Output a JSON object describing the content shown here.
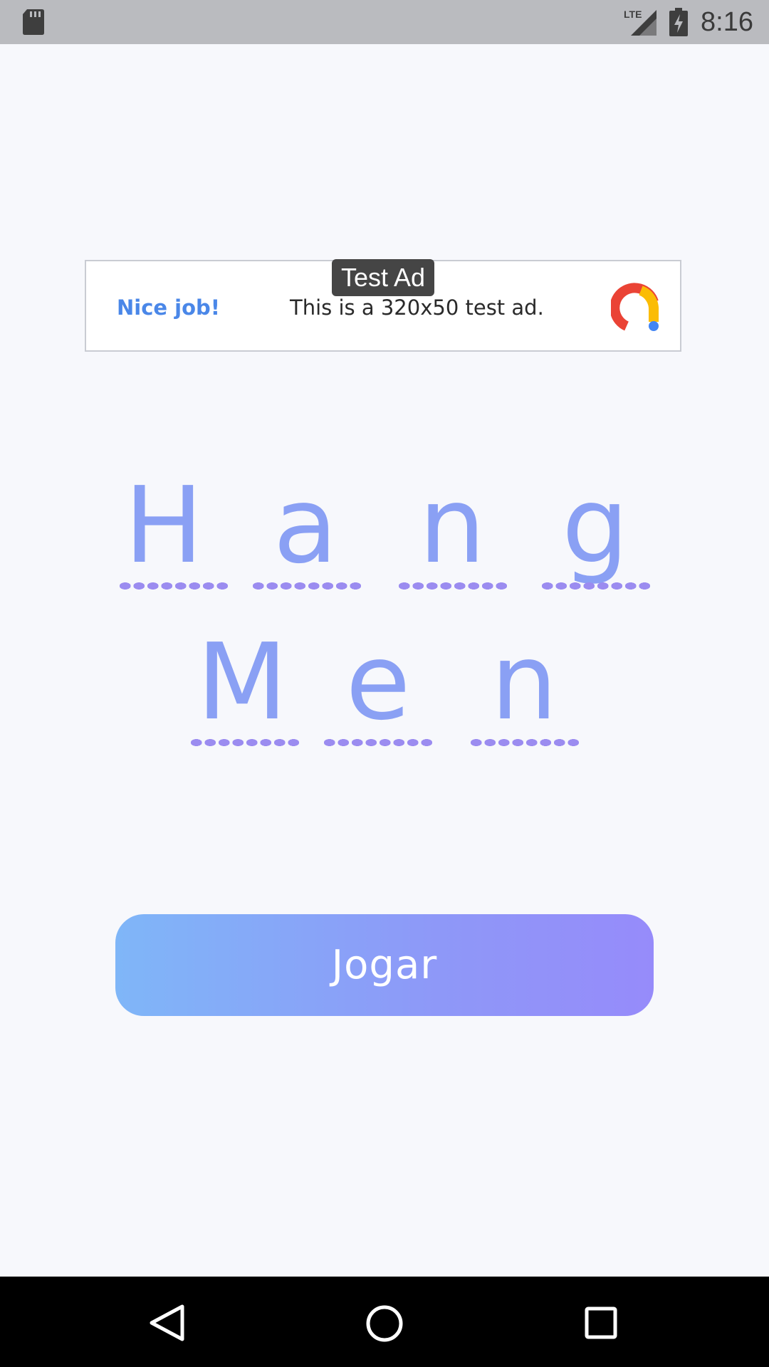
{
  "status_bar": {
    "time": "8:16",
    "network_label": "LTE",
    "icons": [
      "sd-card-icon",
      "lte-signal-icon",
      "battery-charging-icon"
    ]
  },
  "ad": {
    "tag": "Test Ad",
    "headline": "Nice job!",
    "body": "This is a 320x50 test ad.",
    "logo_icon": "ad-logo-icon"
  },
  "title": {
    "row1": [
      "H",
      "a",
      "n",
      "g"
    ],
    "row2": [
      "M",
      "e",
      "n"
    ]
  },
  "play_button": {
    "label": "Jogar"
  },
  "nav_bar": {
    "icons": [
      "back-icon",
      "home-icon",
      "recents-icon"
    ]
  },
  "colors": {
    "background": "#f7f8fc",
    "letter": "#8aa0f4",
    "dash": "#9b8cf0",
    "button_start": "#7fb6f8",
    "button_end": "#968bfa",
    "ad_headline": "#4a87e8"
  }
}
